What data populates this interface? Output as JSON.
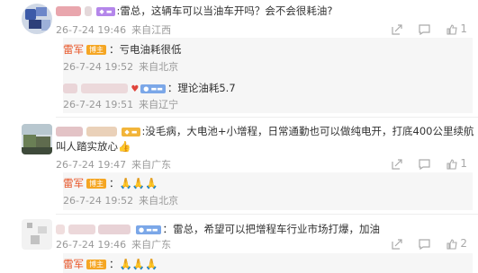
{
  "comments": [
    {
      "text": ":雷总，这辆车可以当油车开吗？会不会很耗油?",
      "meta": {
        "date": "26-7-24 19:46",
        "location": "来自江西"
      },
      "likes": "1",
      "replies": [
        {
          "name": "雷军",
          "badge": "博主",
          "text": "：亏电油耗很低",
          "date": "26-7-24 19:52",
          "location": "来自北京"
        },
        {
          "text": "：理论油耗5.7",
          "date": "26-7-24 19:51",
          "location": "来自辽宁"
        }
      ]
    },
    {
      "text_line1": ":没毛病，大电池+小增程，日常通勤也可以做纯电开，打底400公里续航",
      "text_line2": "叫人踏实放心👍",
      "meta": {
        "date": "26-7-24 19:47",
        "location": "来自广东"
      },
      "likes": "1",
      "replies": [
        {
          "name": "雷军",
          "badge": "博主",
          "text": "：🙏🙏🙏",
          "date": "26-7-24 19:52",
          "location": "来自北京"
        }
      ]
    },
    {
      "text": "：雷总，希望可以把增程车行业市场打爆，加油",
      "meta": {
        "date": "26-7-24 19:46",
        "location": "来自广东"
      },
      "likes": "2",
      "replies": [
        {
          "name": "雷军",
          "badge": "博主",
          "text": "：🙏🙏🙏"
        }
      ]
    }
  ]
}
